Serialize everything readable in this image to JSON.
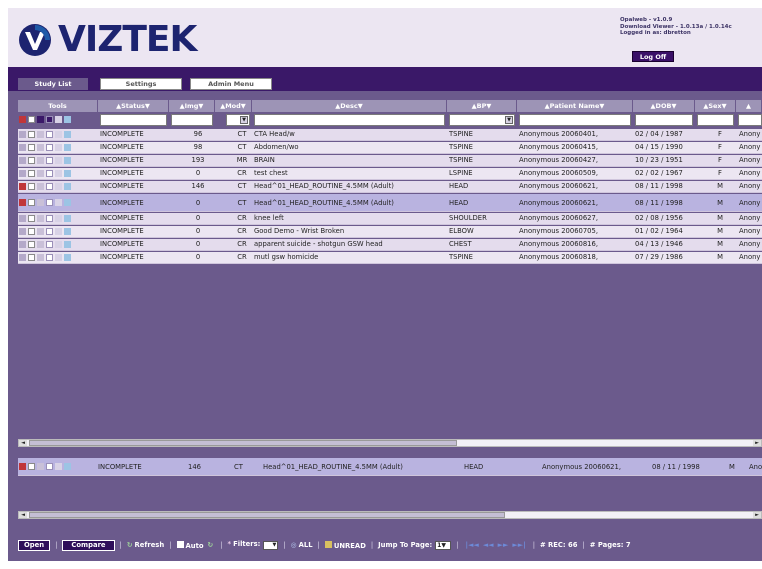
{
  "header": {
    "logo_text": "VIZTEK",
    "version": "Opalweb - v1.0.9",
    "download": "Download Viewer - 1.0.13a / 1.0.14c",
    "logged_in": "Logged in as: dbretton",
    "logoff_label": "Log Off"
  },
  "tabs": [
    {
      "label": "Study List",
      "active": true
    },
    {
      "label": "Settings",
      "active": false
    },
    {
      "label": "Admin Menu",
      "active": false
    }
  ],
  "columns": [
    "Tools",
    "Status",
    "Img",
    "Mod",
    "Desc",
    "BP",
    "Patient Name",
    "DOB",
    "Sex"
  ],
  "rows": [
    {
      "status": "INCOMPLETE",
      "img": "96",
      "mod": "CT",
      "desc": "CTA Head/w",
      "bp": "TSPINE",
      "patient": "Anonymous 20060401,",
      "dob": "02 / 04 / 1987",
      "sex": "F",
      "extra": "Anony"
    },
    {
      "status": "INCOMPLETE",
      "img": "98",
      "mod": "CT",
      "desc": "Abdomen/wo",
      "bp": "TSPINE",
      "patient": "Anonymous 20060415,",
      "dob": "04 / 15 / 1990",
      "sex": "F",
      "extra": "Anony"
    },
    {
      "status": "INCOMPLETE",
      "img": "193",
      "mod": "MR",
      "desc": "BRAIN",
      "bp": "TSPINE",
      "patient": "Anonymous 20060427,",
      "dob": "10 / 23 / 1951",
      "sex": "F",
      "extra": "Anony"
    },
    {
      "status": "INCOMPLETE",
      "img": "0",
      "mod": "CR",
      "desc": "test chest",
      "bp": "LSPINE",
      "patient": "Anonymous 20060509,",
      "dob": "02 / 02 / 1967",
      "sex": "F",
      "extra": "Anony"
    },
    {
      "status": "INCOMPLETE",
      "img": "146",
      "mod": "CT",
      "desc": "Head^01_HEAD_ROUTINE_4.5MM (Adult)",
      "bp": "HEAD",
      "patient": "Anonymous 20060621,",
      "dob": "08 / 11 / 1998",
      "sex": "M",
      "extra": "Anony"
    },
    {
      "status": "INCOMPLETE",
      "img": "0",
      "mod": "CT",
      "desc": "Head^01_HEAD_ROUTINE_4.5MM (Adult)",
      "bp": "HEAD",
      "patient": "Anonymous 20060621,",
      "dob": "08 / 11 / 1998",
      "sex": "M",
      "extra": "Anony"
    },
    {
      "status": "INCOMPLETE",
      "img": "0",
      "mod": "CR",
      "desc": "knee left",
      "bp": "SHOULDER",
      "patient": "Anonymous 20060627,",
      "dob": "02 / 08 / 1956",
      "sex": "M",
      "extra": "Anony"
    },
    {
      "status": "INCOMPLETE",
      "img": "0",
      "mod": "CR",
      "desc": "Good Demo - Wrist Broken",
      "bp": "ELBOW",
      "patient": "Anonymous 20060705,",
      "dob": "01 / 02 / 1964",
      "sex": "M",
      "extra": "Anony"
    },
    {
      "status": "INCOMPLETE",
      "img": "0",
      "mod": "CR",
      "desc": "apparent suicide - shotgun GSW head",
      "bp": "CHEST",
      "patient": "Anonymous 20060816,",
      "dob": "04 / 13 / 1946",
      "sex": "M",
      "extra": "Anony"
    },
    {
      "status": "INCOMPLETE",
      "img": "0",
      "mod": "CR",
      "desc": "mutl gsw homicide",
      "bp": "TSPINE",
      "patient": "Anonymous 20060818,",
      "dob": "07 / 29 / 1986",
      "sex": "M",
      "extra": "Anony"
    }
  ],
  "selected_row": {
    "status": "INCOMPLETE",
    "img": "146",
    "mod": "CT",
    "desc": "Head^01_HEAD_ROUTINE_4.5MM (Adult)",
    "bp": "HEAD",
    "patient": "Anonymous 20060621,",
    "dob": "08 / 11 / 1998",
    "sex": "M",
    "extra": "Ano"
  },
  "toolbar": {
    "open": "Open",
    "compare": "Compare",
    "refresh": "Refresh",
    "auto": "Auto",
    "filters": "Filters:",
    "all": "ALL",
    "unread": "UNREAD",
    "jump": "Jump To Page:",
    "page_value": "1",
    "rec_label": "# REC:",
    "rec_value": "66",
    "pages_label": "# Pages:",
    "pages_value": "7"
  }
}
